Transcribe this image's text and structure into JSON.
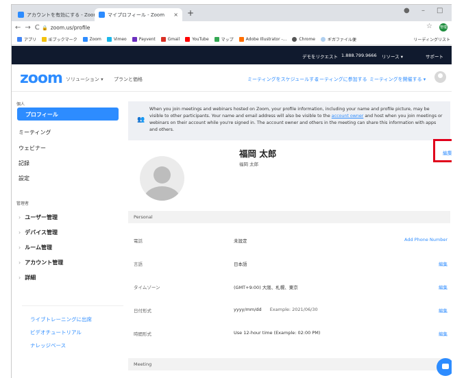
{
  "browser": {
    "tabs": [
      {
        "label": "アカウントを有効にする - Zoom",
        "close": "×"
      },
      {
        "label": "マイプロフィール - Zoom",
        "close": "×"
      }
    ],
    "new_tab": "+",
    "url": "zoom.us/profile",
    "profile_initials": "管理",
    "bookmarks": [
      "アプリ",
      "IEブックマーク",
      "Zoom",
      "Vimeo",
      "Payvent",
      "Gmail",
      "YouTube",
      "マップ",
      "Adobe Illustrator -...",
      "Chrome",
      "ギガファイル便"
    ],
    "bookmarks_right": "リーディングリスト"
  },
  "topbar": {
    "demo": "デモをリクエスト",
    "phone": "1.888.799.9666",
    "resources": "リソース ▾",
    "support": "サポート"
  },
  "nav": {
    "logo": "zoom",
    "solutions": "ソリューション ▾",
    "pricing": "プランと価格",
    "schedule": "ミーティングをスケジュールする",
    "join": "ミーティングに参加する",
    "host": "ミーティングを開催する ▾"
  },
  "sidebar": {
    "personal_heading": "個人",
    "personal": [
      "プロフィール",
      "ミーティング",
      "ウェビナー",
      "記録",
      "設定"
    ],
    "admin_heading": "管理者",
    "admin": [
      "ユーザー管理",
      "デバイス管理",
      "ルーム管理",
      "アカウント管理",
      "詳細"
    ],
    "links": [
      "ライブトレーニングに出席",
      "ビデオチュートリアル",
      "ナレッジベース"
    ]
  },
  "notice": {
    "text_before": "When you join meetings and webinars hosted on Zoom, your profile information, including your name and profile picture, may be visible to other participants. Your name and email address will also be visible to the ",
    "link": "account owner",
    "text_after": " and host when you join meetings or webinars on their account while you're signed in. The account owner and others in the meeting can share this information with apps and others."
  },
  "profile": {
    "name": "福岡 太郎",
    "sub": "福岡 太郎",
    "edit": "編集"
  },
  "sections": {
    "personal": "Personal",
    "meeting": "Meeting"
  },
  "rows": [
    {
      "label": "電話",
      "value": "未設定",
      "example": "",
      "action": "Add Phone Number"
    },
    {
      "label": "言語",
      "value": "日本語",
      "example": "",
      "action": "編集"
    },
    {
      "label": "タイムゾーン",
      "value": "(GMT+9:00) 大阪、札幌、東京",
      "example": "",
      "action": "編集"
    },
    {
      "label": "日付形式",
      "value": "yyyy/mm/dd",
      "example": "Example: 2021/06/30",
      "action": "編集"
    },
    {
      "label": "時間形式",
      "value": "Use 12-hour time (Example: 02:00 PM)",
      "example": "",
      "action": "編集"
    }
  ],
  "colors": {
    "accent": "#2d8cff",
    "topbar": "#101a2e",
    "highlight": "#e0001b"
  }
}
